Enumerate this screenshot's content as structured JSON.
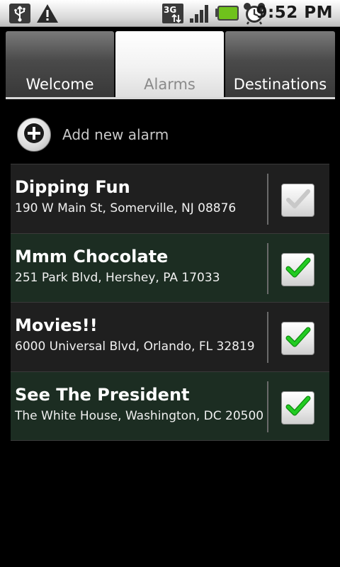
{
  "status_bar": {
    "time": "9:52 PM",
    "network_type": "3G",
    "icons": [
      "usb-icon",
      "warning-icon",
      "signal-icon",
      "battery-icon",
      "alarm-clock-icon"
    ]
  },
  "tabs": [
    {
      "label": "Welcome",
      "selected": false
    },
    {
      "label": "Alarms",
      "selected": true
    },
    {
      "label": "Destinations",
      "selected": false
    }
  ],
  "add_alarm": {
    "label": "Add new alarm",
    "icon": "plus-icon"
  },
  "alarms": [
    {
      "title": "Dipping Fun",
      "address": "190 W Main St, Somerville, NJ 08876",
      "enabled": false
    },
    {
      "title": "Mmm Chocolate",
      "address": "251 Park Blvd, Hershey, PA 17033",
      "enabled": true
    },
    {
      "title": "Movies!!",
      "address": "6000 Universal Blvd, Orlando, FL 32819",
      "enabled": true
    },
    {
      "title": "See The President",
      "address": "The White House, Washington, DC 20500",
      "enabled": true
    }
  ],
  "colors": {
    "check_on": "#22cc22",
    "check_off": "#c8c8c8",
    "row_on_bg": "#1c2d22",
    "row_off_bg": "#1f1f1f",
    "battery": "#6fc21c"
  }
}
